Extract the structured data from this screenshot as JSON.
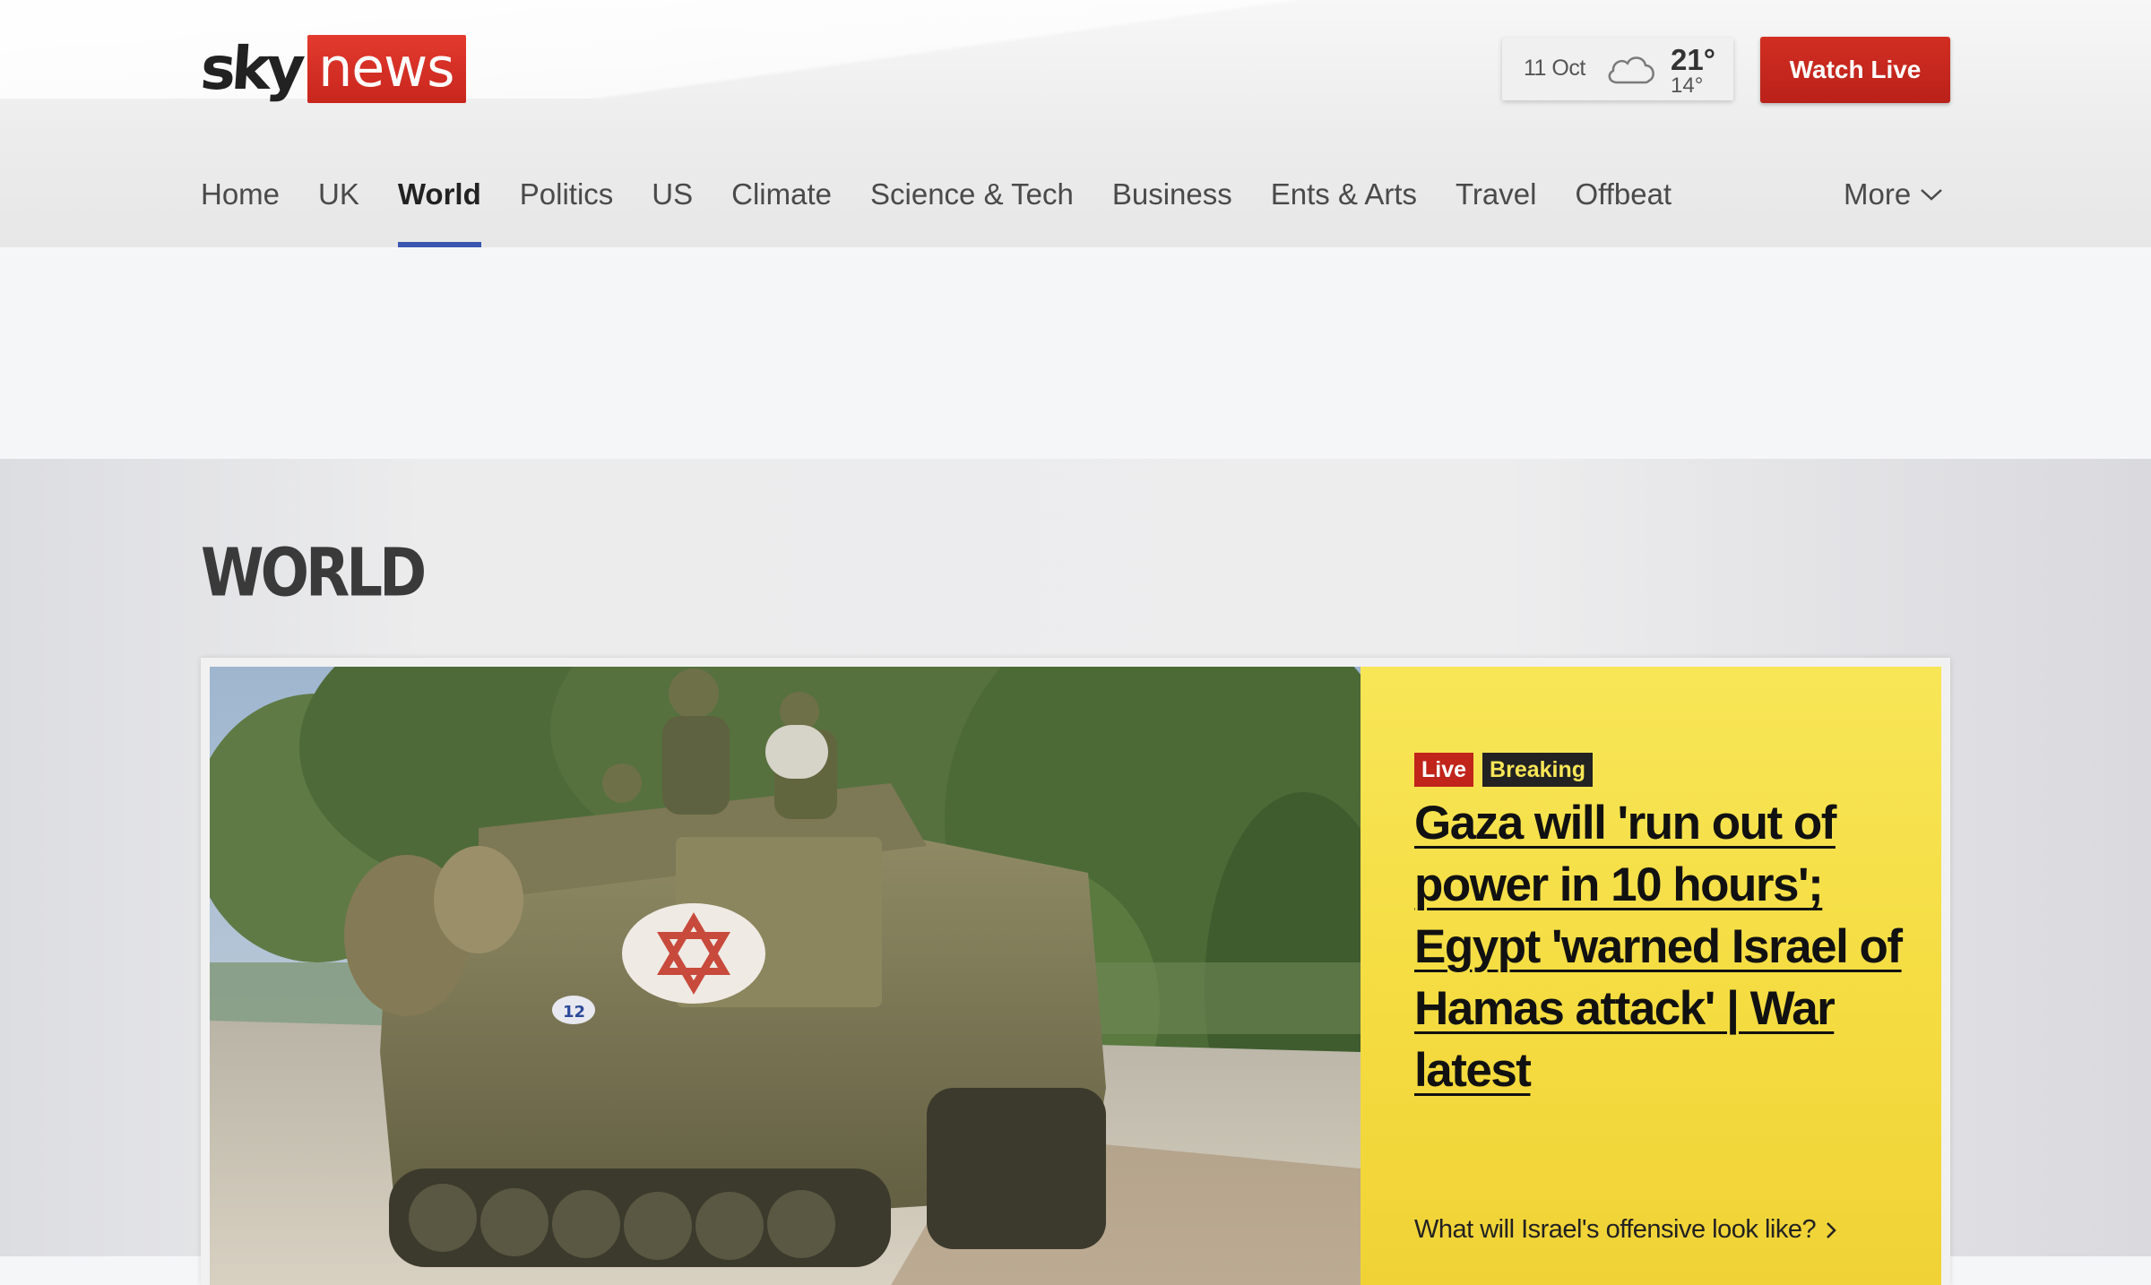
{
  "header": {
    "logo": {
      "sky": "sky",
      "news": "news"
    },
    "weather": {
      "date": "11 Oct",
      "icon": "cloud-icon",
      "high": "21°",
      "low": "14°"
    },
    "watch_live_label": "Watch Live",
    "nav": [
      {
        "label": "Home",
        "active": false
      },
      {
        "label": "UK",
        "active": false
      },
      {
        "label": "World",
        "active": true
      },
      {
        "label": "Politics",
        "active": false
      },
      {
        "label": "US",
        "active": false
      },
      {
        "label": "Climate",
        "active": false
      },
      {
        "label": "Science & Tech",
        "active": false
      },
      {
        "label": "Business",
        "active": false
      },
      {
        "label": "Ents & Arts",
        "active": false
      },
      {
        "label": "Travel",
        "active": false
      },
      {
        "label": "Offbeat",
        "active": false
      }
    ],
    "more_label": "More",
    "colors": {
      "brand_red": "#c8261d",
      "active_nav_underline": "#3a56b0"
    }
  },
  "section": {
    "title": "WORLD",
    "hero": {
      "image_alt": "Israeli soldiers on an armoured personnel carrier marked with a Star of David",
      "badges": {
        "live": "Live",
        "breaking": "Breaking"
      },
      "headline": "Gaza will 'run out of power in 10 hours'; Egypt 'warned Israel of Hamas attack' | War latest",
      "related_link": "What will Israel's offensive look like?",
      "panel_color": "#f4db3f"
    }
  }
}
